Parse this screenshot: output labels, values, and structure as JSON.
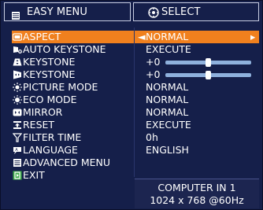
{
  "header": {
    "title": "EASY MENU",
    "title_icon": "menu-list-icon",
    "select_hint": "SELECT",
    "select_icon": "select-circle-icon"
  },
  "menu_items": [
    {
      "label": "ASPECT",
      "value": "NORMAL",
      "icon": "aspect-icon",
      "selected": true,
      "prefix": "◄",
      "suffix": "▸"
    },
    {
      "label": "AUTO KEYSTONE",
      "value": "EXECUTE",
      "icon": "auto-keystone-icon"
    },
    {
      "label": "KEYSTONE",
      "value": "+0",
      "icon": "keystone-vertical-icon",
      "slider_level": 0.5
    },
    {
      "label": "KEYSTONE",
      "value": "+0",
      "icon": "keystone-horizontal-icon",
      "slider_level": 0.5
    },
    {
      "label": "PICTURE MODE",
      "value": "NORMAL",
      "icon": "picture-mode-icon"
    },
    {
      "label": "ECO MODE",
      "value": "NORMAL",
      "icon": "eco-mode-icon"
    },
    {
      "label": "MIRROR",
      "value": "NORMAL",
      "icon": "mirror-icon"
    },
    {
      "label": "RESET",
      "value": "EXECUTE",
      "icon": "reset-icon"
    },
    {
      "label": "FILTER TIME",
      "value": "0h",
      "icon": "filter-time-icon"
    },
    {
      "label": "LANGUAGE",
      "value": "ENGLISH",
      "icon": "language-icon"
    },
    {
      "label": "ADVANCED MENU",
      "value": "",
      "icon": "advanced-menu-icon"
    },
    {
      "label": "EXIT",
      "value": "",
      "icon": "exit-icon"
    }
  ],
  "status": {
    "source": "COMPUTER IN 1",
    "signal": "1024 x 768 @60Hz"
  },
  "colors": {
    "background": "#151f4a",
    "highlight": "#f0801e",
    "slider": "#8fb1dd"
  }
}
